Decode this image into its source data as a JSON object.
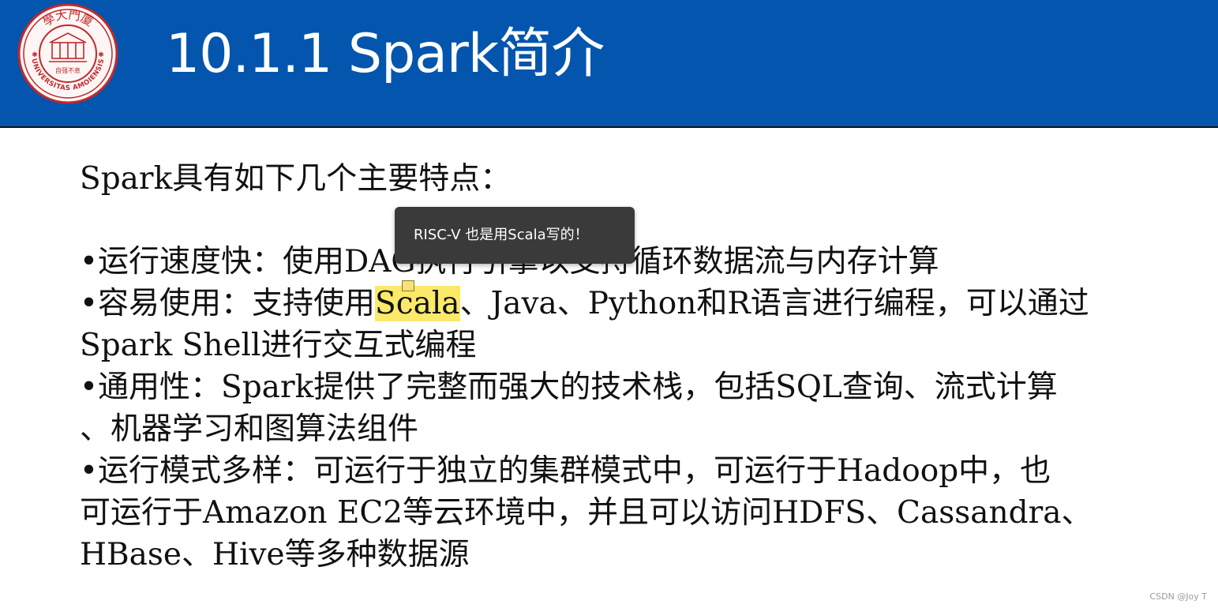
{
  "header": {
    "title": "10.1.1 Spark简介",
    "logo": {
      "top_text": "學大門廈",
      "bottom_text": "UNIVERSITAS AMOIENSIS",
      "motto": "自强不息"
    }
  },
  "content": {
    "intro": "Spark具有如下几个主要特点：",
    "items": [
      {
        "text": "•运行速度快：使用DAG执行引擎以支持循环数据流与内存计算"
      },
      {
        "before": "•容易使用：支持使用",
        "highlight": "Scala",
        "after": "、Java、Python和R语言进行编程，可以通过",
        "line2": "Spark Shell进行交互式编程"
      },
      {
        "text": "•通用性：Spark提供了完整而强大的技术栈，包括SQL查询、流式计算",
        "line2": "、机器学习和图算法组件"
      },
      {
        "text": "•运行模式多样：可运行于独立的集群模式中，可运行于Hadoop中，也",
        "line2": "可运行于Amazon EC2等云环境中，并且可以访问HDFS、Cassandra、",
        "line3": "HBase、Hive等多种数据源"
      }
    ]
  },
  "tooltip": {
    "text": "RISC-V 也是用Scala写的！"
  },
  "watermark": {
    "text": "CSDN @Joy T"
  },
  "colors": {
    "header": "#0455ad",
    "highlight": "#fbe96a",
    "tooltip_bg": "#3a3a3a",
    "seal": "#c0282d"
  }
}
